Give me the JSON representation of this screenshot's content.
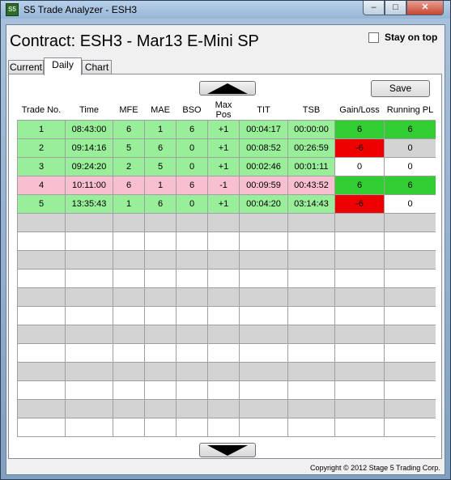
{
  "window": {
    "icon_text": "S5",
    "title": "S5 Trade Analyzer - ESH3",
    "minimize_glyph": "–",
    "maximize_glyph": "□",
    "close_glyph": "✕"
  },
  "contract_label": "Contract: ESH3 - Mar13 E-Mini SP",
  "stay_on_top": {
    "label": "Stay on top",
    "checked": false
  },
  "tabs": [
    {
      "label": "Current",
      "active": false
    },
    {
      "label": "Daily",
      "active": true
    },
    {
      "label": "Chart",
      "active": false
    }
  ],
  "toolbar": {
    "save_label": "Save",
    "scroll_up_icon": "triangle-up-icon",
    "scroll_down_icon": "triangle-down-icon"
  },
  "table": {
    "headers": [
      "Trade No.",
      "Time",
      "MFE",
      "MAE",
      "BSO",
      "Max\nPos",
      "TIT",
      "TSB",
      "Gain/Loss",
      "Running PL"
    ],
    "rows": [
      {
        "result": "win",
        "cells": [
          "1",
          "08:43:00",
          "6",
          "1",
          "6",
          "+1",
          "00:04:17",
          "00:00:00",
          "6",
          "6"
        ]
      },
      {
        "result": "win",
        "cells": [
          "2",
          "09:14:16",
          "5",
          "6",
          "0",
          "+1",
          "00:08:52",
          "00:26:59",
          "-6",
          "0"
        ]
      },
      {
        "result": "win",
        "cells": [
          "3",
          "09:24:20",
          "2",
          "5",
          "0",
          "+1",
          "00:02:46",
          "00:01:11",
          "0",
          "0"
        ]
      },
      {
        "result": "loss",
        "cells": [
          "4",
          "10:11:00",
          "6",
          "1",
          "6",
          "-1",
          "00:09:59",
          "00:43:52",
          "6",
          "6"
        ]
      },
      {
        "result": "win",
        "cells": [
          "5",
          "13:35:43",
          "1",
          "6",
          "0",
          "+1",
          "00:04:20",
          "03:14:43",
          "-6",
          "0"
        ]
      }
    ],
    "empty_rows": 12
  },
  "colors": {
    "long_row": "#99ee99",
    "short_row": "#f8bfd0",
    "gain": "#32cd32",
    "loss": "#ee0000"
  },
  "copyright": "Copyright © 2012 Stage 5 Trading Corp."
}
